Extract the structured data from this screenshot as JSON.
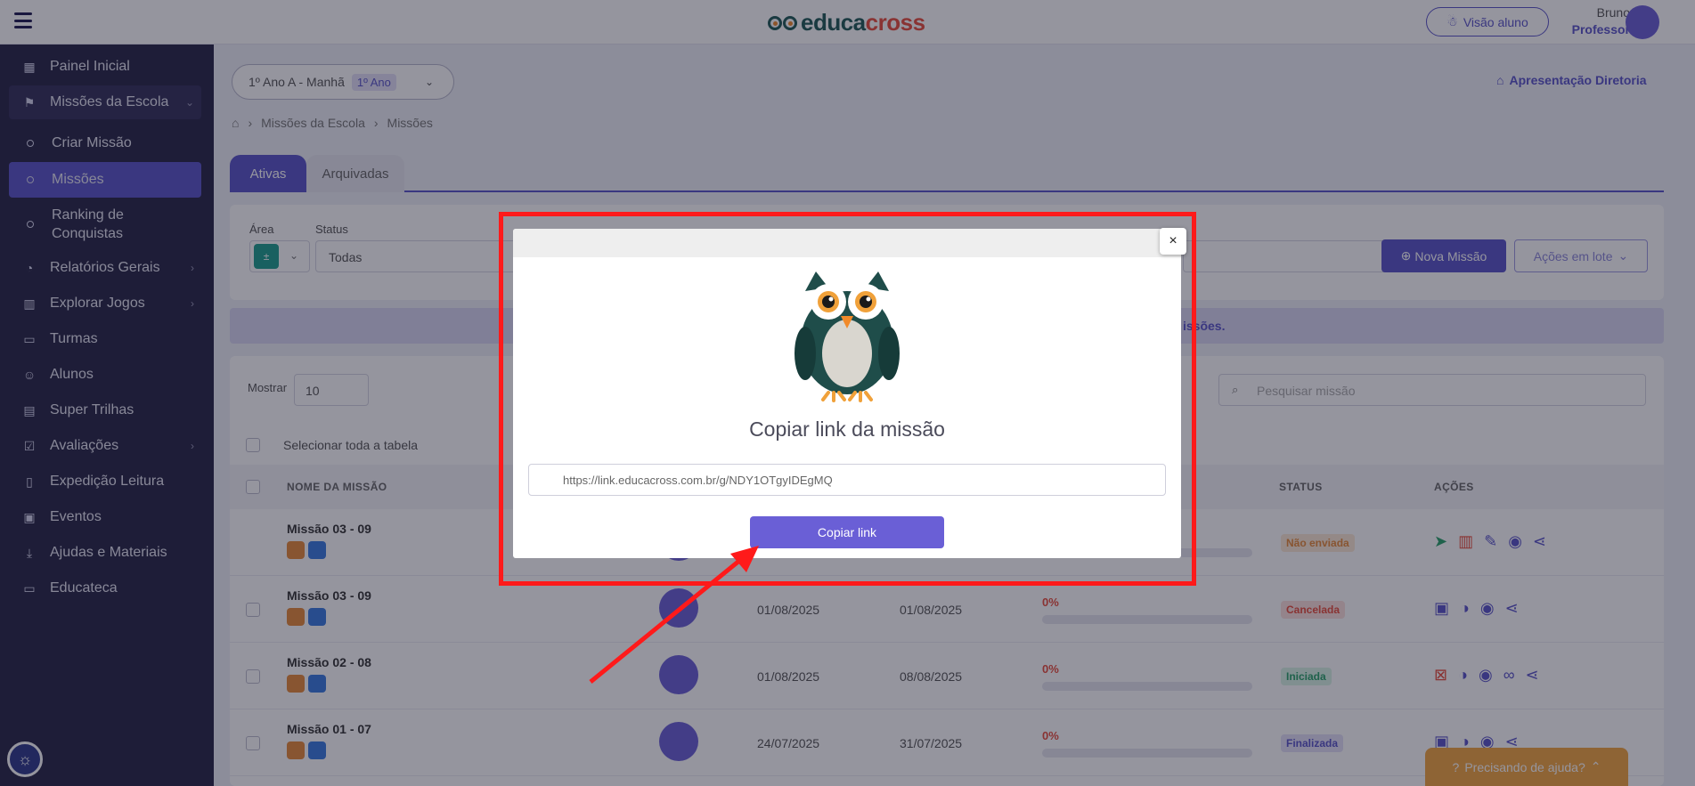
{
  "topbar": {
    "logo_text_main": "educa",
    "logo_text_accent": "cross",
    "visao_aluno": "Visão aluno",
    "user_name": "Bruno",
    "user_role": "Professor"
  },
  "sidebar": {
    "items": [
      {
        "label": "Painel Inicial",
        "icon": "grid-icon"
      },
      {
        "label": "Missões da Escola",
        "icon": "flag-icon"
      },
      {
        "label": "Criar Missão"
      },
      {
        "label": "Missões"
      },
      {
        "label": "Ranking de Conquistas"
      },
      {
        "label": "Relatórios Gerais",
        "icon": "chart-pie-icon"
      },
      {
        "label": "Explorar Jogos",
        "icon": "map-icon"
      },
      {
        "label": "Turmas",
        "icon": "briefcase-icon"
      },
      {
        "label": "Alunos",
        "icon": "users-icon"
      },
      {
        "label": "Super Trilhas",
        "icon": "book-icon"
      },
      {
        "label": "Avaliações",
        "icon": "checklist-icon"
      },
      {
        "label": "Expedição Leitura",
        "icon": "book-open-icon"
      },
      {
        "label": "Eventos",
        "icon": "calendar-icon"
      },
      {
        "label": "Ajudas e Materiais",
        "icon": "download-icon"
      },
      {
        "label": "Educateca",
        "icon": "monitor-icon"
      }
    ]
  },
  "main": {
    "class_select": "1º Ano A - Manhã",
    "class_badge": "1º Ano",
    "apresentacao": "Apresentação Diretoria",
    "breadcrumb": [
      "Missões da Escola",
      "Missões"
    ],
    "tabs": [
      "Ativas",
      "Arquivadas"
    ],
    "filters": {
      "area_label": "Área",
      "status_label": "Status",
      "status_value": "Todas",
      "nova_missao": "Nova Missão",
      "acoes_lote": "Ações em lote"
    },
    "info_text": "issões.",
    "table": {
      "mostrar_label": "Mostrar",
      "mostrar_value": "10",
      "search_placeholder": "Pesquisar missão",
      "select_all": "Selecionar toda a tabela",
      "headers": [
        "NOME DA MISSÃO",
        "STATUS",
        "AÇÕES"
      ],
      "rows": [
        {
          "name": "Missão 03 - 09",
          "start": "",
          "end": "",
          "progress": "",
          "status": "Não enviada"
        },
        {
          "name": "Missão 03 - 09",
          "start": "01/08/2025",
          "end": "01/08/2025",
          "progress": "0%",
          "status": "Cancelada"
        },
        {
          "name": "Missão 02 - 08",
          "start": "01/08/2025",
          "end": "08/08/2025",
          "progress": "0%",
          "status": "Iniciada"
        },
        {
          "name": "Missão 01 - 07",
          "start": "24/07/2025",
          "end": "31/07/2025",
          "progress": "0%",
          "status": "Finalizada"
        }
      ]
    },
    "help_button": "Precisando de ajuda?"
  },
  "modal": {
    "close": "×",
    "title": "Copiar link da missão",
    "link": "https://link.educacross.com.br/g/NDY1OTgyIDEgMQ",
    "copy_button": "Copiar link"
  },
  "colors": {
    "primary": "#5a55c9",
    "sidebar": "#272545",
    "annotation": "#ff1a1a"
  }
}
